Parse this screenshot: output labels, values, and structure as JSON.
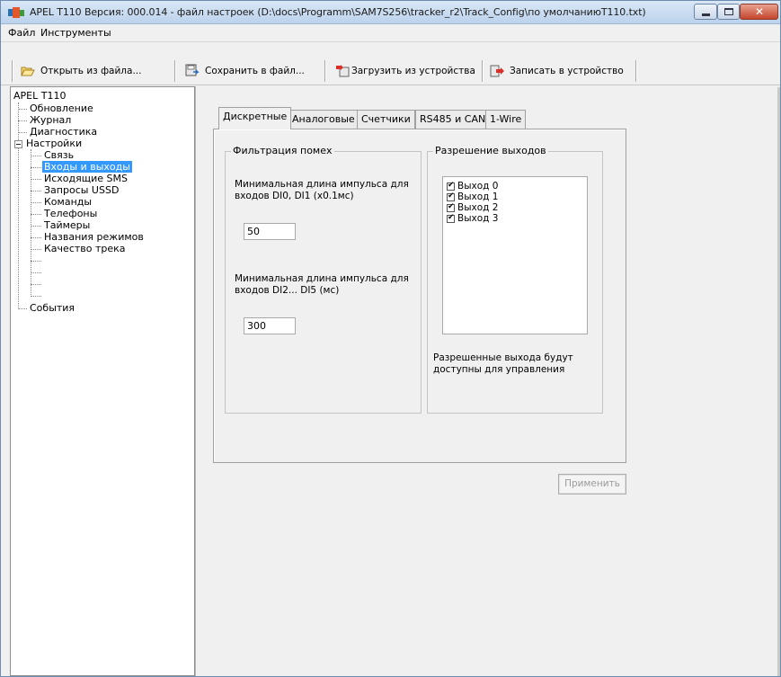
{
  "window": {
    "title": "APEL T110    Версия: 000.014 - файл настроек (D:\\docs\\Programm\\SAM7S256\\tracker_r2\\Track_Config\\по умолчаниюT110.txt)"
  },
  "menu": {
    "file": "Файл",
    "tools": "Инструменты"
  },
  "toolbar": {
    "open": "Открыть из файла...",
    "save": "Сохранить в файл...",
    "load_device": "Загрузить из устройства",
    "write_device": "Записать в устройство"
  },
  "tree": {
    "root": "APEL T110",
    "items": [
      {
        "label": "Обновление"
      },
      {
        "label": "Журнал"
      },
      {
        "label": "Диагностика"
      },
      {
        "label": "Настройки"
      },
      {
        "label": "Связь"
      },
      {
        "label": "Входы и выходы"
      },
      {
        "label": "Исходящие SMS"
      },
      {
        "label": "Запросы USSD"
      },
      {
        "label": "Команды"
      },
      {
        "label": "Телефоны"
      },
      {
        "label": "Таймеры"
      },
      {
        "label": "Названия режимов"
      },
      {
        "label": "Качество трека"
      },
      {
        "label": "События"
      }
    ]
  },
  "tabs": [
    {
      "label": "Дискретные"
    },
    {
      "label": "Аналоговые"
    },
    {
      "label": "Счетчики"
    },
    {
      "label": "RS485 и CAN"
    },
    {
      "label": "1-Wire"
    }
  ],
  "filter_group": {
    "title": "Фильтрация помех",
    "label1_line1": "Минимальная длина импульса для",
    "label1_line2": "входов  DI0, DI1 (x0.1мс)",
    "value1": "50",
    "label2_line1": "Минимальная длина импульса для",
    "label2_line2": "входов  DI2... DI5 (мс)",
    "value2": "300"
  },
  "outputs_group": {
    "title": "Разрешение  выходов",
    "items": [
      {
        "label": "Выход 0",
        "checked": true
      },
      {
        "label": "Выход 1",
        "checked": true
      },
      {
        "label": "Выход 2",
        "checked": true
      },
      {
        "label": "Выход 3",
        "checked": true
      }
    ],
    "note_line1": "Разрешенные выхода будут",
    "note_line2": "доступны для управления"
  },
  "apply_button": "Применить"
}
